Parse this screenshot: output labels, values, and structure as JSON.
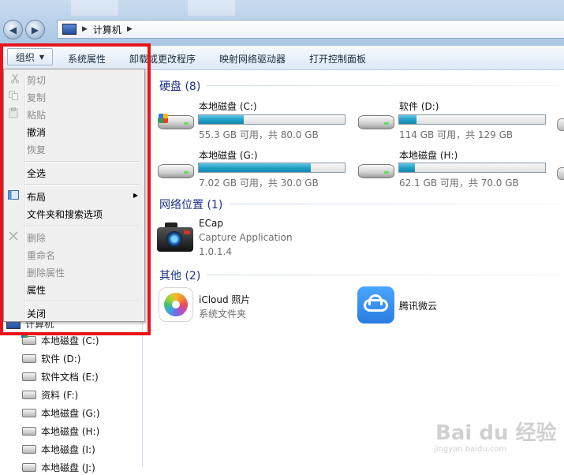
{
  "address_bar": {
    "crumb": "计算机"
  },
  "toolbar": {
    "organize": "组织",
    "system_properties": "系统属性",
    "uninstall": "卸载或更改程序",
    "map_drive": "映射网络驱动器",
    "control_panel": "打开控制面板"
  },
  "menu": {
    "cut": "剪切",
    "copy": "复制",
    "paste": "粘贴",
    "undo": "撤消",
    "redo": "恢复",
    "select_all": "全选",
    "layout": "布局",
    "folder_options": "文件夹和搜索选项",
    "delete": "删除",
    "rename": "重命名",
    "remove_properties": "删除属性",
    "properties": "属性",
    "close": "关闭"
  },
  "nav": {
    "computer": "计算机",
    "items": [
      "本地磁盘 (C:)",
      "软件 (D:)",
      "软件文档 (E:)",
      "资料 (F:)",
      "本地磁盘 (G:)",
      "本地磁盘 (H:)",
      "本地磁盘 (I:)",
      "本地磁盘 (J:)"
    ]
  },
  "groups": {
    "hard_disks": "硬盘 (8)",
    "network": "网络位置 (1)",
    "other": "其他 (2)"
  },
  "drives": [
    {
      "name": "本地磁盘 (C:)",
      "info": "55.3 GB 可用，共 80.0 GB",
      "used_fraction": 0.31
    },
    {
      "name": "软件 (D:)",
      "info": "114 GB 可用，共 129 GB",
      "used_fraction": 0.12
    },
    {
      "name": "本地磁盘 (G:)",
      "info": "7.02 GB 可用，共 30.0 GB",
      "used_fraction": 0.77
    },
    {
      "name": "本地磁盘 (H:)",
      "info": "62.1 GB 可用，共 70.0 GB",
      "used_fraction": 0.11
    }
  ],
  "network_item": {
    "name": "ECap",
    "desc": "Capture Application",
    "version": "1.0.1.4"
  },
  "other_items": [
    {
      "name": "iCloud 照片",
      "desc": "系统文件夹"
    },
    {
      "name": "腾讯微云"
    }
  ],
  "watermark": {
    "brand": "Bai du 经验",
    "url": "jingyan.baidu.com"
  },
  "colors": {
    "highlight_box": "#e8141a",
    "group_header": "#1e3287",
    "capacity_bar": "#1f9ec6"
  }
}
